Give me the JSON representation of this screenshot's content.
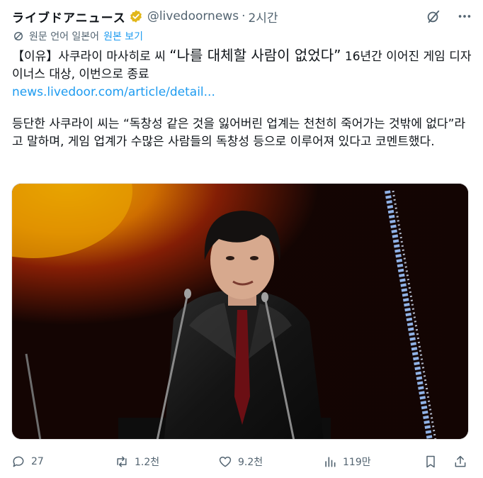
{
  "header": {
    "author": "ライブドアニュース",
    "handle": "@livedoornews",
    "dot": "·",
    "time": "2시간"
  },
  "icons": {
    "verified": "verified-badge-icon",
    "grok": "grok-icon",
    "more": "more-icon",
    "translate": "translate-icon",
    "reply": "reply-icon",
    "retweet": "retweet-icon",
    "like": "heart-icon",
    "views": "views-icon",
    "bookmark": "bookmark-icon",
    "share": "share-icon"
  },
  "translate": {
    "label": "원문 언어 일본어",
    "link": "원본 보기"
  },
  "post": {
    "headline_prefix": "【이유】사쿠라이 마사히로 씨 ",
    "headline_quote": "“나를 대체할 사람이 없었다”",
    "headline_suffix": " 16년간 이어진 게임 디자이너스 대상, 이번으로 종료",
    "url": "news.livedoor.com/article/detail...",
    "body": "등단한 사쿠라이 씨는 “독창성 같은 것을 잃어버린 업계는 천천히 죽어가는 것밖에 없다”라고 말하며, 게임 업계가 수많은 사람들의 독창성 등으로 이루어져 있다고 코멘트했다."
  },
  "stats": {
    "replies": "27",
    "retweets": "1.2천",
    "likes": "9.2천",
    "views": "119만"
  },
  "colors": {
    "accent": "#1d9bf0",
    "muted": "#536471",
    "verified_gold": "#e2b719"
  }
}
